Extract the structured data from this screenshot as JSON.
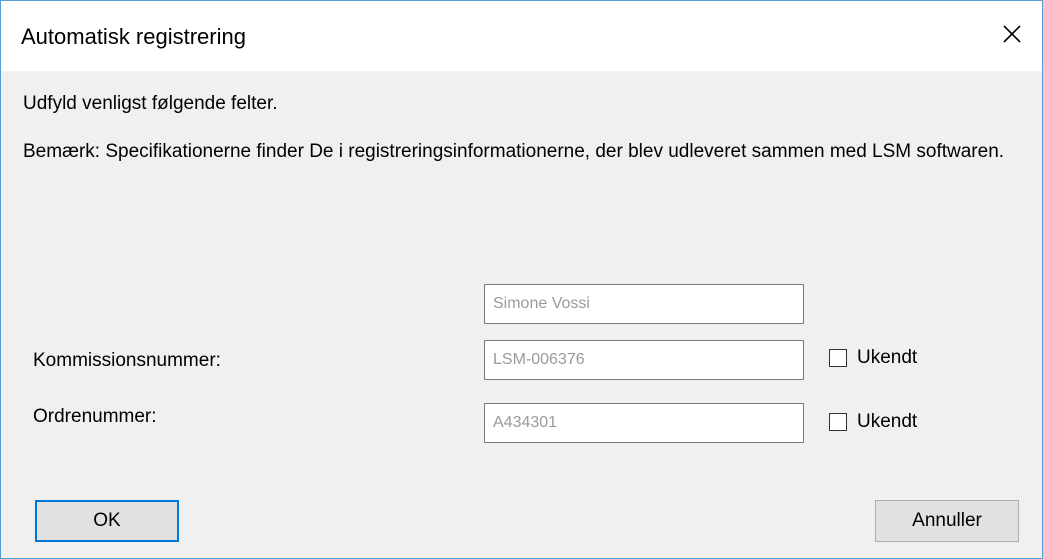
{
  "dialog": {
    "title": "Automatisk registrering",
    "close_icon": "close-icon"
  },
  "content": {
    "instruction": "Udfyld venligst følgende felter.",
    "note": "Bemærk: Specifikationerne finder De i registreringsinformationerne, der blev udleveret sammen med LSM softwaren."
  },
  "fields": {
    "name": {
      "value": "Simone Vossi"
    },
    "commission": {
      "label": "Kommissionsnummer:",
      "value": "LSM-006376",
      "unknown_label": "Ukendt",
      "unknown_checked": false
    },
    "order": {
      "label": "Ordrenummer:",
      "value": "A434301",
      "unknown_label": "Ukendt",
      "unknown_checked": false
    }
  },
  "buttons": {
    "ok": "OK",
    "cancel": "Annuller"
  }
}
